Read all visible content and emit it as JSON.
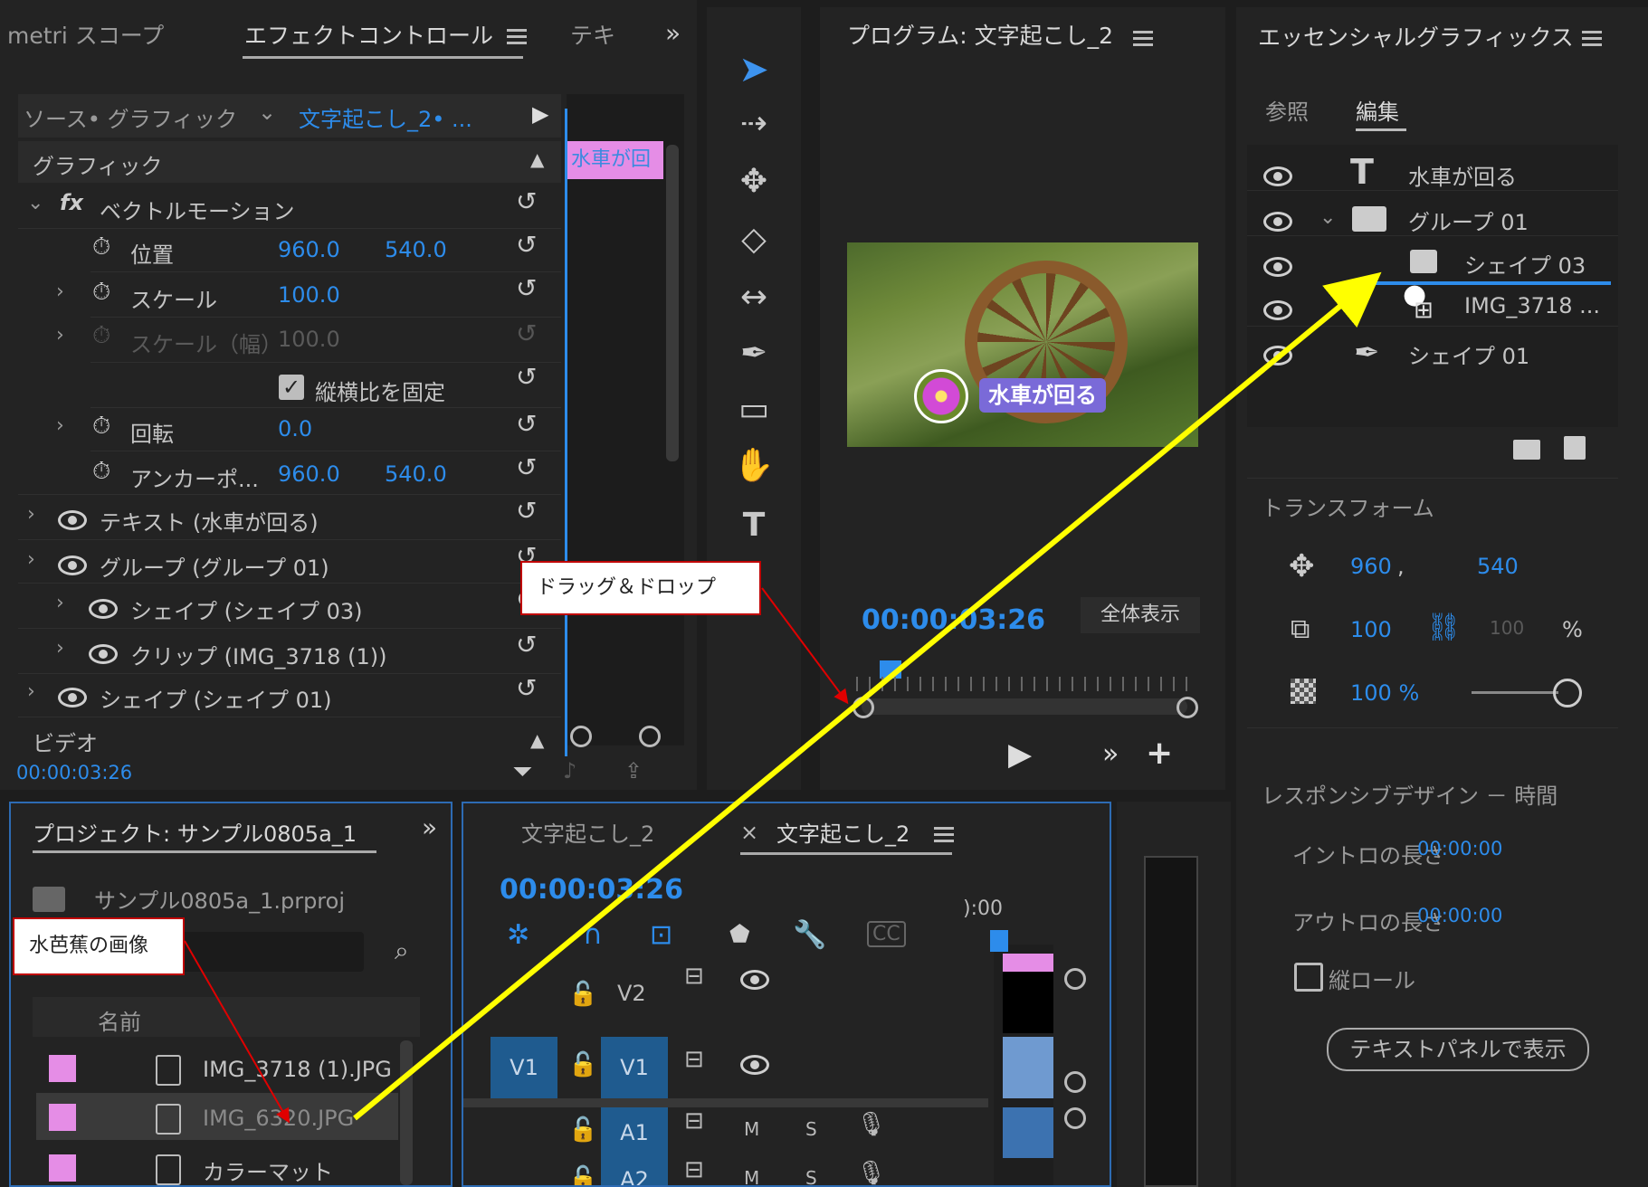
{
  "effect_panel": {
    "tabs": [
      "metri スコープ",
      "エフェクトコントロール",
      "テキ"
    ],
    "source_label": "ソース• グラフィック",
    "clip_label": "文字起こし_2• ...",
    "section_graphic": "グラフィック",
    "vector_motion": "ベクトルモーション",
    "position": {
      "label": "位置",
      "x": "960.0",
      "y": "540.0"
    },
    "scale": {
      "label": "スケール",
      "value": "100.0"
    },
    "scale_width": {
      "label": "スケール（幅）",
      "value": "100.0"
    },
    "lock_aspect": "縦横比を固定",
    "rotation": {
      "label": "回転",
      "value": "0.0"
    },
    "anchor": {
      "label": "アンカーポ...",
      "x": "960.0",
      "y": "540.0"
    },
    "layers": [
      "テキスト (水車が回る)",
      "グループ (グループ 01)",
      "シェイプ (シェイプ 03)",
      "クリップ (IMG_3718 (1))",
      "シェイプ (シェイプ 01)"
    ],
    "video_section": "ビデオ",
    "timecode": "00:00:03:26",
    "mini_clip_text": "水車が回"
  },
  "program_monitor": {
    "title": "プログラム: 文字起こし_2",
    "caption": "水車が回る",
    "timecode": "00:00:03:26",
    "fit_label": "全体表示"
  },
  "essential_graphics": {
    "title": "エッセンシャルグラフィックス",
    "tabs": [
      "参照",
      "編集"
    ],
    "layers": [
      "水車が回る",
      "グループ 01",
      "シェイプ 03",
      "IMG_3718 ...",
      "シェイプ 01"
    ],
    "transform_label": "トランスフォーム",
    "pos_x": "960",
    "pos_sep": ",",
    "pos_y": "540",
    "scale": "100",
    "scale_h": "100",
    "percent": "%",
    "opacity": "100 %",
    "responsive": "レスポンシブデザイン － 時間",
    "intro_label": "イントロの長さ",
    "intro_value": "00:00:00",
    "outro_label": "アウトロの長さ",
    "outro_value": "00:00:00",
    "roll_label": "縦ロール",
    "text_panel_button": "テキストパネルで表示"
  },
  "project_panel": {
    "title": "プロジェクト: サンプル0805a_1",
    "file": "サンプル0805a_1.prproj",
    "column_name": "名前",
    "items": [
      "IMG_3718 (1).JPG",
      "IMG_6320.JPG",
      "カラーマット"
    ]
  },
  "timeline": {
    "tabs": [
      "文字起こし_2",
      "文字起こし_2"
    ],
    "close": "×",
    "timecode": "00:00:03:26",
    "ruler": "):00",
    "tracks": [
      "V2",
      "V1",
      "A1",
      "A2"
    ],
    "source_v1": "V1",
    "m": "M",
    "s": "S"
  },
  "callouts": {
    "drag": "ドラッグ＆ドロップ",
    "image": "水芭蕉の画像"
  },
  "colors": {
    "accent": "#2d8ceb",
    "swatch": "#e58de6",
    "arrow": "#ffff00",
    "callout_border": "#c00000"
  }
}
